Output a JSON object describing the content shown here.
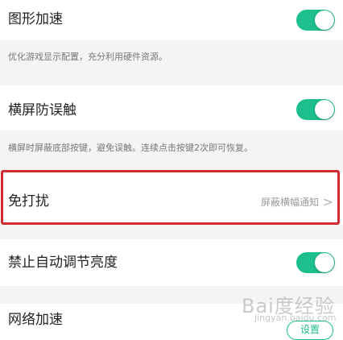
{
  "settings": {
    "graphics_accel": {
      "title": "图形加速",
      "description": "优化游戏显示配置，充分利用硬件资源。",
      "enabled": true
    },
    "landscape_touch_guard": {
      "title": "横屏防误触",
      "description": "横屏时屏蔽底部按键，避免误触。连续点击按键2次即可恢复。",
      "enabled": true
    },
    "do_not_disturb": {
      "title": "免打扰",
      "value": "屏蔽横幅通知",
      "chevron": ">"
    },
    "disable_auto_brightness": {
      "title": "禁止自动调节亮度",
      "enabled": true
    },
    "network_accel": {
      "title": "网络加速",
      "button_label": "设置"
    }
  },
  "watermark": {
    "brand": "Bai度经验",
    "sub": "jingyan.baidu.com"
  },
  "colors": {
    "accent": "#1dbf8c",
    "highlight": "#d42a33"
  }
}
